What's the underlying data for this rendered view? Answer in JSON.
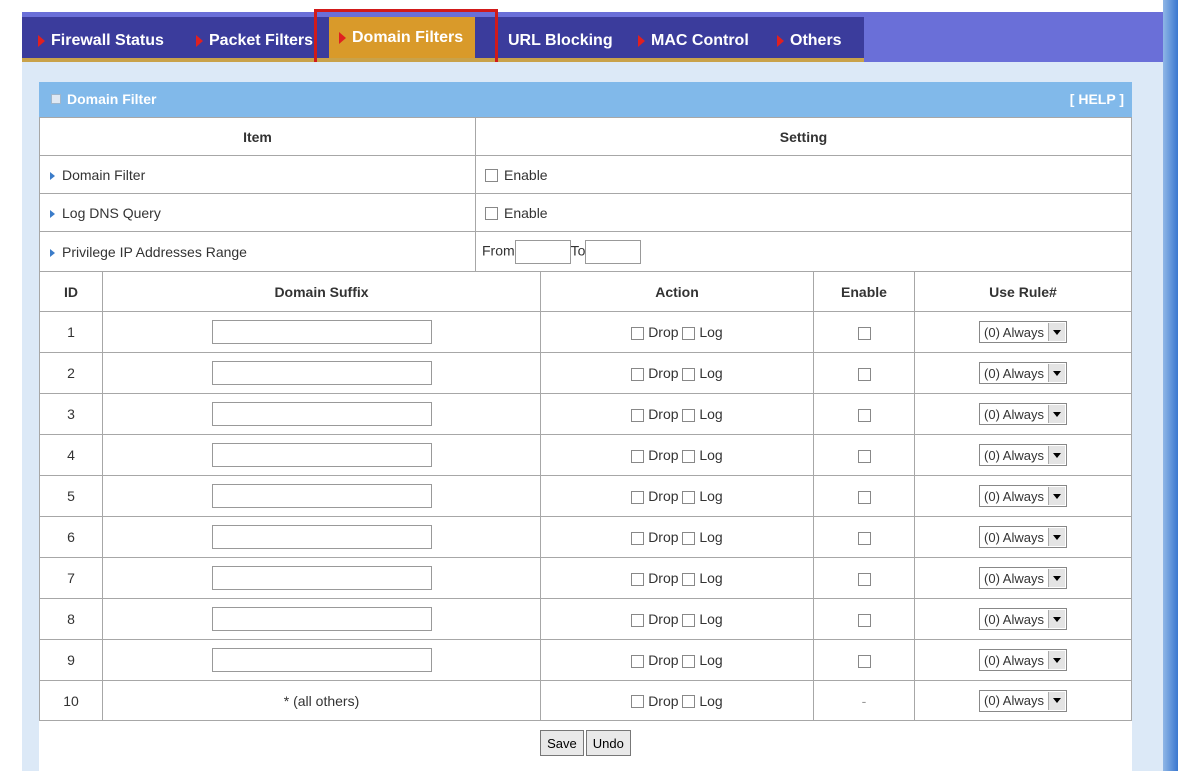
{
  "tabs": [
    {
      "label": "Firewall Status",
      "active": false
    },
    {
      "label": "Packet Filters",
      "active": false
    },
    {
      "label": "Domain Filters",
      "active": true
    },
    {
      "label": "URL Blocking",
      "active": false
    },
    {
      "label": "MAC Control",
      "active": false
    },
    {
      "label": "Others",
      "active": false
    }
  ],
  "panel": {
    "title": "Domain Filter",
    "help": "[ HELP ]"
  },
  "settings": {
    "col_item": "Item",
    "col_setting": "Setting",
    "rows": [
      {
        "label": "Domain Filter",
        "control": "Enable"
      },
      {
        "label": "Log DNS Query",
        "control": "Enable"
      },
      {
        "label": "Privilege IP Addresses Range",
        "from": "From",
        "to": "To"
      }
    ]
  },
  "rules": {
    "col_id": "ID",
    "col_suffix": "Domain Suffix",
    "col_action": "Action",
    "col_enable": "Enable",
    "col_rule": "Use Rule#",
    "drop": "Drop",
    "log": "Log",
    "rule_option": "(0) Always",
    "last_row": {
      "id": "10",
      "suffix": "* (all others)",
      "enable": "-"
    },
    "rows": [
      "1",
      "2",
      "3",
      "4",
      "5",
      "6",
      "7",
      "8",
      "9"
    ]
  },
  "buttons": {
    "save": "Save",
    "undo": "Undo"
  },
  "colors": {
    "tab_bg": "#3b3c9c",
    "tab_active": "#d99a2a",
    "panel_header": "#81b9ea",
    "highlight_box": "#d11a1a"
  }
}
